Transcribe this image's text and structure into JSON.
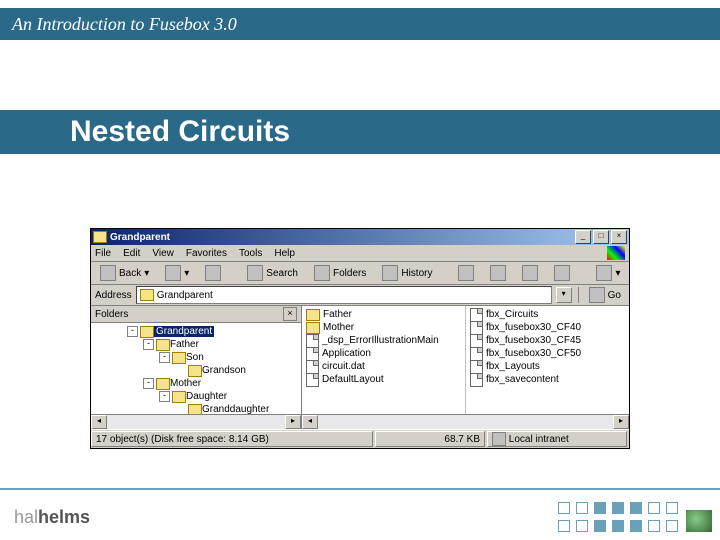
{
  "header": {
    "deck_title": "An Introduction to Fusebox 3.0"
  },
  "slide": {
    "title": "Nested Circuits"
  },
  "explorer": {
    "window_title": "Grandparent",
    "menus": [
      "File",
      "Edit",
      "View",
      "Favorites",
      "Tools",
      "Help"
    ],
    "toolbar": {
      "back": "Back",
      "search": "Search",
      "folders": "Folders",
      "history": "History"
    },
    "address": {
      "label": "Address",
      "value": "Grandparent",
      "go": "Go"
    },
    "tree": {
      "header": "Folders",
      "nodes": [
        {
          "indent": 36,
          "twist": "-",
          "label": "Grandparent",
          "selected": true
        },
        {
          "indent": 52,
          "twist": "-",
          "label": "Father"
        },
        {
          "indent": 68,
          "twist": "-",
          "label": "Son"
        },
        {
          "indent": 84,
          "twist": "",
          "label": "Grandson"
        },
        {
          "indent": 52,
          "twist": "-",
          "label": "Mother"
        },
        {
          "indent": 68,
          "twist": "-",
          "label": "Daughter"
        },
        {
          "indent": 84,
          "twist": "",
          "label": "Granddaughter"
        }
      ]
    },
    "list": {
      "col1": [
        {
          "icon": "folder",
          "label": "Father"
        },
        {
          "icon": "folder",
          "label": "Mother"
        },
        {
          "icon": "doc",
          "label": "_dsp_ErrorIllustrationMain"
        },
        {
          "icon": "doc",
          "label": "Application"
        },
        {
          "icon": "doc",
          "label": "circuit.dat"
        },
        {
          "icon": "doc",
          "label": "DefaultLayout"
        }
      ],
      "col2": [
        {
          "icon": "doc",
          "label": "fbx_Circuits"
        },
        {
          "icon": "doc",
          "label": "fbx_fusebox30_CF40"
        },
        {
          "icon": "doc",
          "label": "fbx_fusebox30_CF45"
        },
        {
          "icon": "doc",
          "label": "fbx_fusebox30_CF50"
        },
        {
          "icon": "doc",
          "label": "fbx_Layouts"
        },
        {
          "icon": "doc",
          "label": "fbx_savecontent"
        }
      ]
    },
    "status": {
      "left": "17 object(s) (Disk free space: 8.14 GB)",
      "mid": "68.7 KB",
      "right": "Local intranet"
    }
  },
  "footer": {
    "logo_a": "hal",
    "logo_b": "helms"
  }
}
